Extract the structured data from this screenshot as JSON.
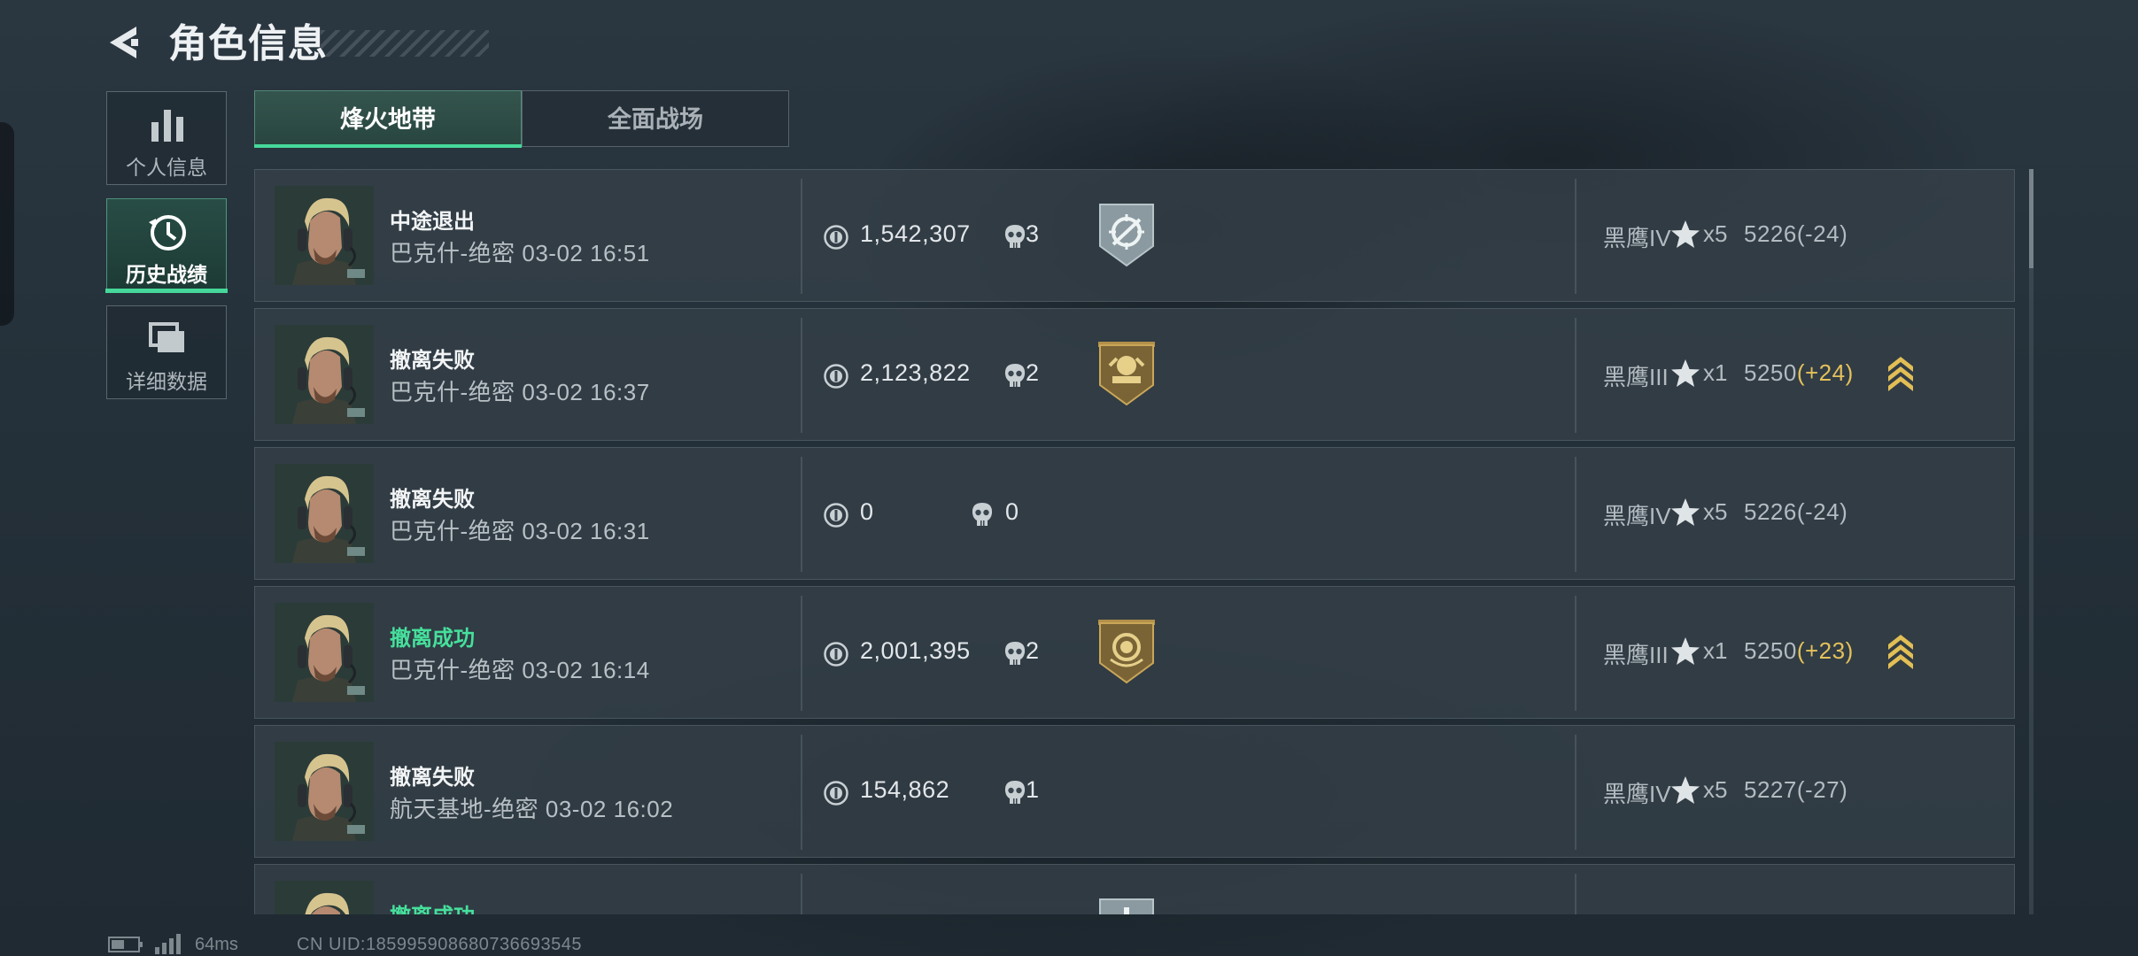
{
  "header": {
    "title": "角色信息",
    "back_icon": "back-arrow-icon"
  },
  "nav": [
    {
      "label": "个人信息",
      "icon": "bar-chart-icon",
      "active": false
    },
    {
      "label": "历史战绩",
      "icon": "history-clock-icon",
      "active": true
    },
    {
      "label": "详细数据",
      "icon": "stacked-cards-icon",
      "active": false
    }
  ],
  "tabs": [
    {
      "label": "烽火地带",
      "active": true
    },
    {
      "label": "全面战场",
      "active": false
    }
  ],
  "matches": [
    {
      "status": "中途退出",
      "status_type": "normal",
      "map_time": "巴克什-绝密 03-02 16:51",
      "value": "1,542,307",
      "kills": "3",
      "badge": "crosshair-badge-icon",
      "rank": "黑鹰IV",
      "stars": "x5",
      "score": "5226",
      "delta": "(-24)",
      "delta_type": "loss",
      "chevron": false
    },
    {
      "status": "撤离失败",
      "status_type": "normal",
      "map_time": "巴克什-绝密 03-02 16:37",
      "value": "2,123,822",
      "kills": "2",
      "badge": "gold-crest-badge-icon",
      "rank": "黑鹰III",
      "stars": "x1",
      "score": "5250",
      "delta": "(+24)",
      "delta_type": "gain",
      "chevron": true
    },
    {
      "status": "撤离失败",
      "status_type": "normal",
      "map_time": "巴克什-绝密 03-02 16:31",
      "value": "0",
      "kills": "0",
      "badge": "",
      "rank": "黑鹰IV",
      "stars": "x5",
      "score": "5226",
      "delta": "(-24)",
      "delta_type": "loss",
      "chevron": false
    },
    {
      "status": "撤离成功",
      "status_type": "success",
      "map_time": "巴克什-绝密 03-02 16:14",
      "value": "2,001,395",
      "kills": "2",
      "badge": "gold-coin-badge-icon",
      "rank": "黑鹰III",
      "stars": "x1",
      "score": "5250",
      "delta": "(+23)",
      "delta_type": "gain",
      "chevron": true
    },
    {
      "status": "撤离失败",
      "status_type": "normal",
      "map_time": "航天基地-绝密 03-02 16:02",
      "value": "154,862",
      "kills": "1",
      "badge": "",
      "rank": "黑鹰IV",
      "stars": "x5",
      "score": "5227",
      "delta": "(-27)",
      "delta_type": "loss",
      "chevron": false
    },
    {
      "status": "撤离成功",
      "status_type": "success",
      "map_time": "",
      "value": "",
      "kills": "",
      "badge": "partial-badge-icon",
      "rank": "",
      "stars": "",
      "score": "",
      "delta": "",
      "delta_type": "loss",
      "chevron": false
    }
  ],
  "footer": {
    "ping": "64ms",
    "uid": "CN UID:185995908680736693545"
  },
  "colors": {
    "accent_green": "#46d89a",
    "success_text": "#46e09c",
    "gain_gold": "#e4c15a"
  }
}
